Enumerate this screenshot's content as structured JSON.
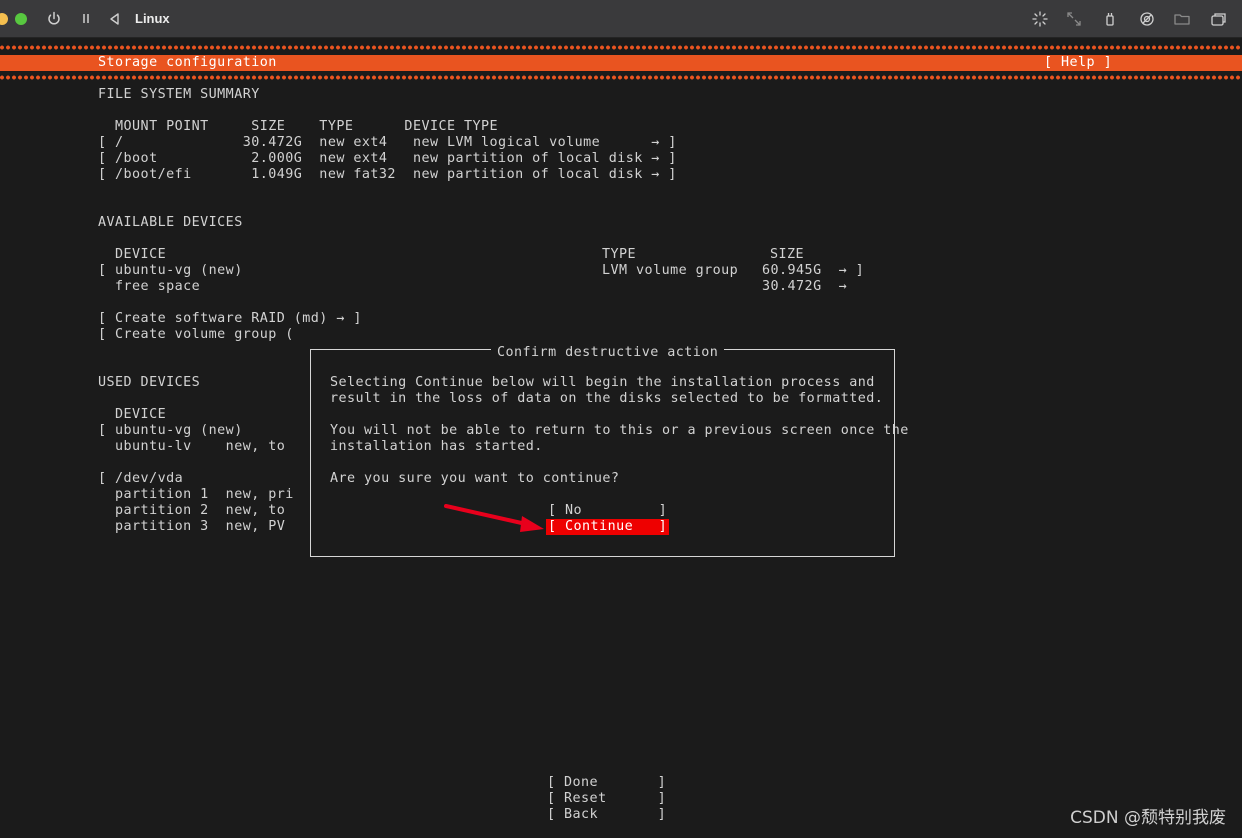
{
  "window": {
    "title": "Linux",
    "icons_left": [
      "power-icon",
      "pause-icon",
      "back-triangle-icon"
    ],
    "icons_right": [
      "brightness-icon",
      "fullscreen-icon",
      "usb-icon",
      "audio-icon",
      "folder-icon",
      "window-icon"
    ]
  },
  "header": {
    "title": "Storage configuration",
    "help_label": "[ Help ]"
  },
  "fs_summary": {
    "heading": "FILE SYSTEM SUMMARY",
    "columns": "  MOUNT POINT     SIZE    TYPE      DEVICE TYPE",
    "rows": [
      "[ /              30.472G  new ext4   new LVM logical volume      → ]",
      "[ /boot           2.000G  new ext4   new partition of local disk → ]",
      "[ /boot/efi       1.049G  new fat32  new partition of local disk → ]"
    ]
  },
  "available": {
    "heading": "AVAILABLE DEVICES",
    "col_device": "  DEVICE",
    "col_type": "TYPE",
    "col_size": "SIZE",
    "vg_name": "[ ubuntu-vg (new)",
    "vg_type": "LVM volume group",
    "vg_size": "60.945G  → ]",
    "free_label": "  free space",
    "free_size": "30.472G  →",
    "create_raid": "[ Create software RAID (md) → ]",
    "create_vg": "[ Create volume group ("
  },
  "used": {
    "heading": "USED DEVICES",
    "col_device": "  DEVICE",
    "rows": [
      "[ ubuntu-vg (new)",
      "  ubuntu-lv    new, to",
      "",
      "[ /dev/vda",
      "  partition 1  new, pri",
      "  partition 2  new, to",
      "  partition 3  new, PV"
    ]
  },
  "dialog": {
    "title": "Confirm destructive action",
    "line1": "Selecting Continue below will begin the installation process and",
    "line2": "result in the loss of data on the disks selected to be formatted.",
    "line3": "You will not be able to return to this or a previous screen once the",
    "line4": "installation has started.",
    "question": "Are you sure you want to continue?",
    "no_label": "[ No         ]",
    "continue_label": "[ Continue   ]"
  },
  "footer": {
    "done_label": "[ Done       ]",
    "reset_label": "[ Reset      ]",
    "back_label": "[ Back       ]"
  },
  "watermark": "CSDN @颓特别我废",
  "colors": {
    "accent": "#e95420",
    "selected": "#ee0000",
    "annotation_arrow": "#e8001c"
  }
}
